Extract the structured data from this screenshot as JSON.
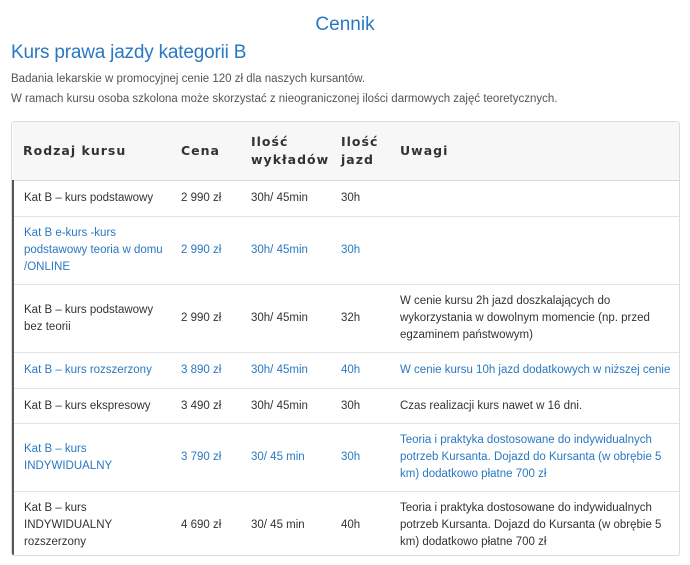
{
  "page": {
    "title": "Cennik",
    "course_title": "Kurs prawa jazdy kategorii B",
    "intro_line1": "Badania lekarskie w promocyjnej cenie 120 zł dla naszych kursantów.",
    "intro_line2": "W ramach kursu osoba szkolona może skorzystać z nieograniczonej ilości darmowych zajęć teoretycznych."
  },
  "table": {
    "headers": {
      "kind": "Rodzaj kursu",
      "price": "Cena",
      "lectures_1": "Ilość",
      "lectures_2": "wykładów",
      "drives_1": "Ilość",
      "drives_2": "jazd",
      "notes": "Uwagi"
    },
    "rows": [
      {
        "kind": "Kat B – kurs podstawowy",
        "price": "2 990 zł",
        "lectures": "30h/ 45min",
        "drives": "30h",
        "notes": "",
        "link": false
      },
      {
        "kind": "Kat B e-kurs -kurs podstawowy teoria w domu /ONLINE",
        "price": "2 990 zł",
        "lectures": "30h/ 45min",
        "drives": "30h",
        "notes": "",
        "link": true
      },
      {
        "kind": "Kat B – kurs podstawowy bez teorii",
        "price": "2 990 zł",
        "lectures": "30h/ 45min",
        "drives": "32h",
        "notes": "W cenie kursu 2h jazd doszkalających do wykorzystania w dowolnym momencie (np. przed egzaminem państwowym)",
        "link": false
      },
      {
        "kind": "Kat B – kurs rozszerzony",
        "price": "3 890 zł",
        "lectures": "30h/ 45min",
        "drives": "40h",
        "notes": "W cenie kursu 10h jazd dodatkowych w niższej cenie",
        "link": true
      },
      {
        "kind": "Kat B – kurs ekspresowy",
        "price": "3 490 zł",
        "lectures": "30h/ 45min",
        "drives": "30h",
        "notes": "Czas realizacji kurs nawet w 16 dni.",
        "link": false
      },
      {
        "kind": "Kat B – kurs INDYWIDUALNY",
        "price": "3 790 zł",
        "lectures": "30/ 45 min",
        "drives": "30h",
        "notes": "Teoria i praktyka dostosowane do indywidualnych potrzeb Kursanta. Dojazd do Kursanta (w obrębie 5 km) dodatkowo płatne 700 zł",
        "link": true
      },
      {
        "kind": "Kat B – kurs INDYWIDUALNY rozszerzony",
        "price": "4 690 zł",
        "lectures": "30/ 45 min",
        "drives": "40h",
        "notes": "Teoria i praktyka dostosowane do indywidualnych potrzeb Kursanta. Dojazd do Kursanta (w obrębie 5 km) dodatkowo płatne 700 zł",
        "link": false
      }
    ]
  }
}
